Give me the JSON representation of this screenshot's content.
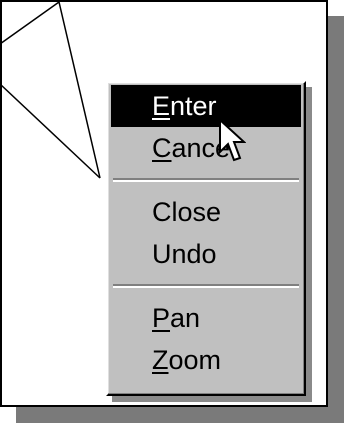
{
  "context_menu": {
    "items": [
      {
        "mnemonic": "E",
        "rest": "nter",
        "highlighted": true
      },
      {
        "mnemonic": "C",
        "rest": "ancel",
        "highlighted": false
      },
      {
        "mnemonic": "",
        "rest": "Close",
        "highlighted": false
      },
      {
        "mnemonic": "",
        "rest": "Undo",
        "highlighted": false
      },
      {
        "mnemonic": "P",
        "rest": "an",
        "highlighted": false
      },
      {
        "mnemonic": "Z",
        "rest": "oom",
        "highlighted": false
      }
    ]
  },
  "colors": {
    "menu_background": "#c0c0c0",
    "highlight_background": "#000000",
    "highlight_text": "#ffffff",
    "text": "#000000"
  },
  "icons": {
    "cursor": "arrow-cursor-icon"
  }
}
